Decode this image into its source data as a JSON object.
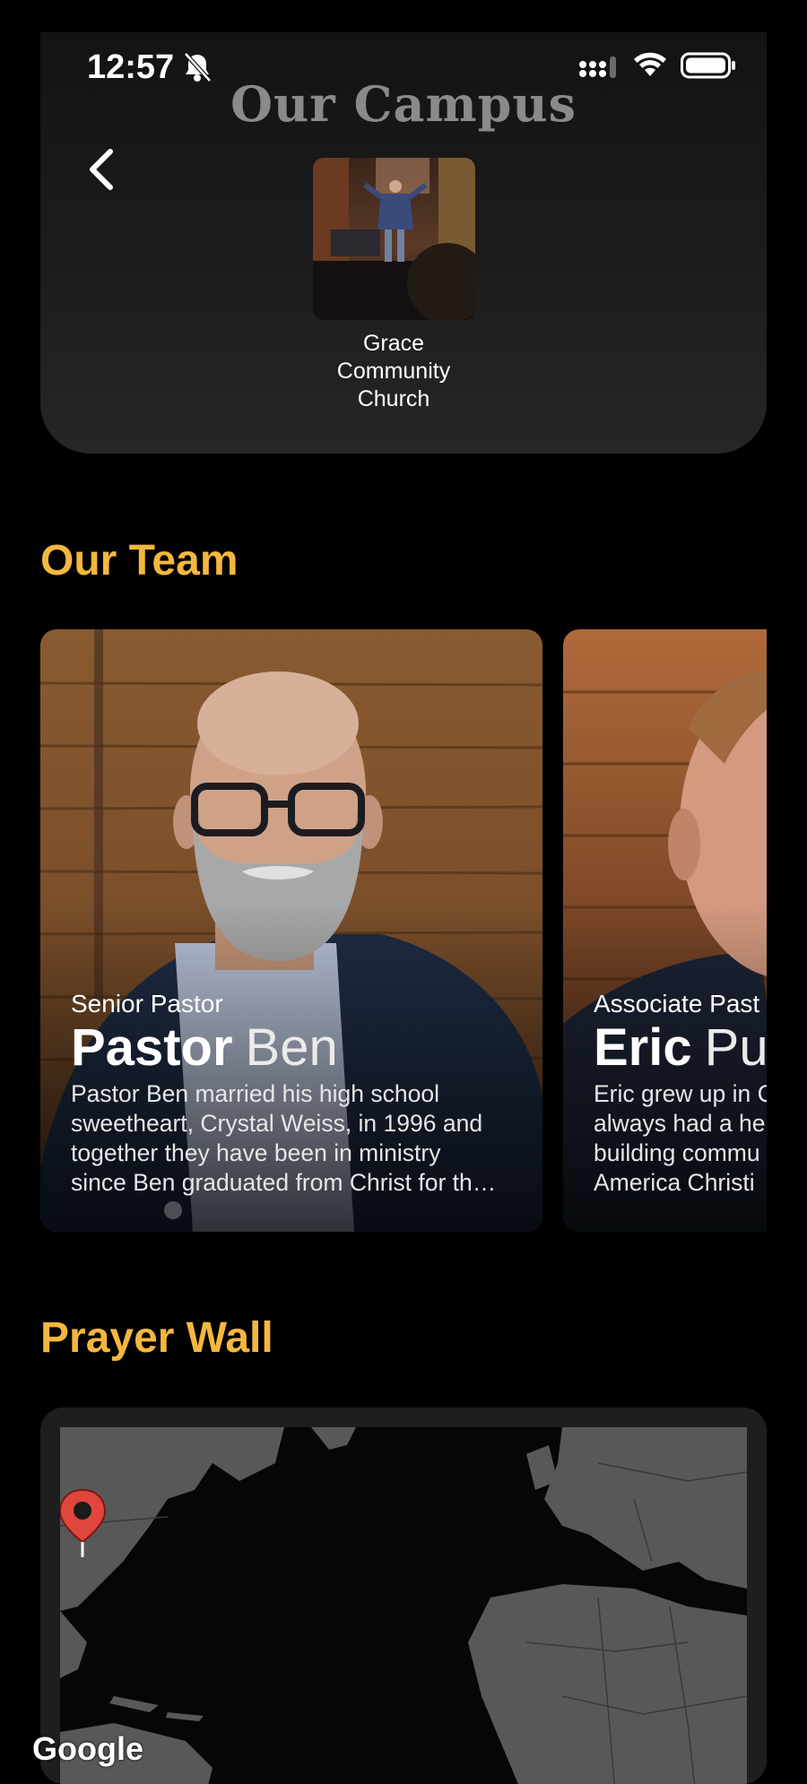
{
  "status_bar": {
    "time": "12:57"
  },
  "campus": {
    "title": "Our Campus",
    "name_line1": "Grace",
    "name_line2": "Community",
    "name_line3": "Church"
  },
  "team": {
    "heading": "Our Team",
    "members": [
      {
        "role": "Senior Pastor",
        "first_name": "Pastor",
        "last_name": "Ben",
        "bio_lines": [
          "Pastor Ben married his high school",
          "sweetheart, Crystal Weiss, in 1996 and",
          "together they have been in ministry",
          "since Ben graduated from Christ for th…"
        ]
      },
      {
        "role": "Associate Past",
        "first_name": "Eric",
        "last_name": "Pu",
        "bio_lines": [
          "Eric grew up in C",
          "always had a he",
          "building commu",
          "America Christi"
        ]
      }
    ]
  },
  "prayer_wall": {
    "heading": "Prayer Wall",
    "map_attribution": "Google"
  },
  "colors": {
    "accent": "#f4b73e",
    "background": "#000000",
    "pin": "#e0463c"
  },
  "icons": [
    "bell-slash-icon",
    "cellular-signal-icon",
    "wifi-icon",
    "battery-icon",
    "chevron-left-icon",
    "map-pin-icon"
  ]
}
